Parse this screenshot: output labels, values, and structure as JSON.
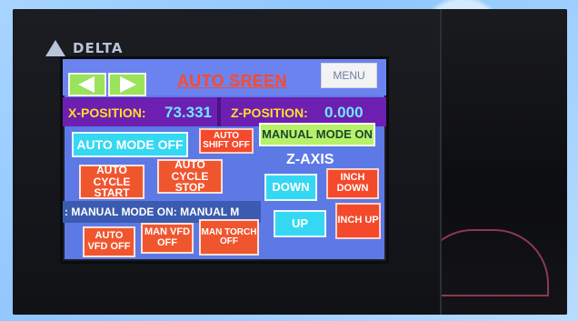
{
  "device": {
    "brand": "DELTA"
  },
  "hmi": {
    "title": "AUTO SREEN",
    "menu_label": "MENU",
    "x_position_label": "X-POSITION:",
    "x_position_value": "73.331",
    "z_position_label": "Z-POSITION:",
    "z_position_value": "0.000",
    "buttons": {
      "auto_mode": "AUTO MODE OFF",
      "auto_shift": "AUTO SHIFT OFF",
      "manual_mode": "MANUAL MODE ON",
      "auto_cycle_start": "AUTO CYCLE START",
      "auto_cycle_stop": "AUTO CYCLE STOP",
      "down": "DOWN",
      "inch_down": "INCH DOWN",
      "up": "UP",
      "inch_up": "INCH UP",
      "auto_vfd": "AUTO VFD OFF",
      "man_vfd": "MAN VFD OFF",
      "man_torch": "MAN TORCH OFF"
    },
    "z_axis_label": "Z-AXIS",
    "marquee_text": ": MANUAL MODE ON: MANUAL M"
  },
  "colors": {
    "hmi_background": "#5d79e6",
    "position_strip": "#6d1fb2",
    "title": "#ff4a2b",
    "label_yellow": "#ffdf2a",
    "value_cyan": "#6ee6ff",
    "button_orange": "#f0562e",
    "button_cyan": "#35d8f2",
    "button_green": "#b8f06a"
  },
  "icons": {
    "nav_left": "arrow-left-icon",
    "nav_right": "arrow-right-icon",
    "logo": "delta-logo-icon"
  }
}
